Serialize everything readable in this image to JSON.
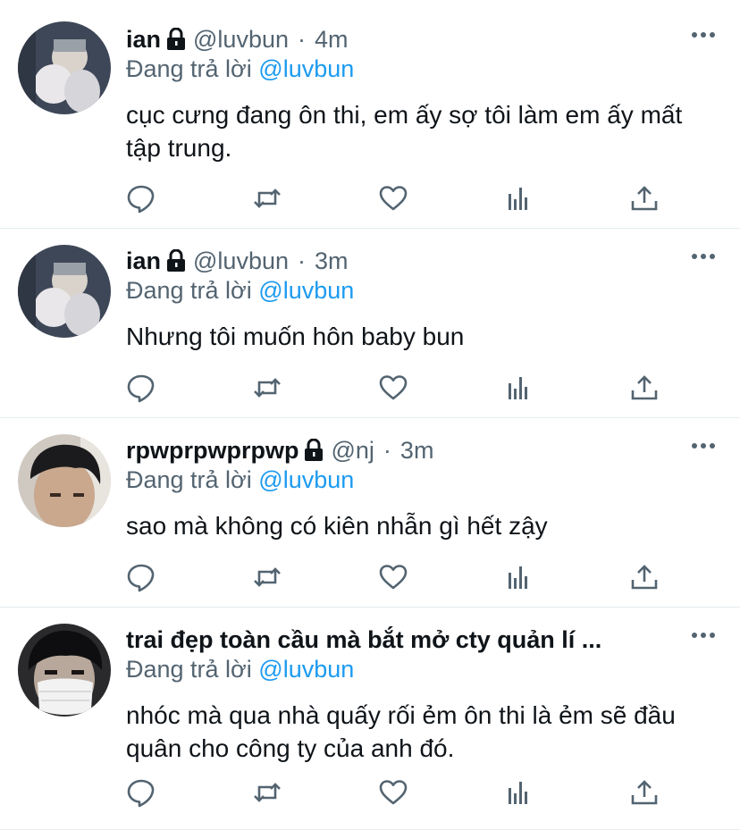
{
  "tweets": [
    {
      "name": "ian",
      "handle": "@luvbun",
      "dot": "·",
      "time": "4m",
      "reply_prefix": "Đang trả lời",
      "reply_to": "@luvbun",
      "text": "cục cưng đang ôn thi, em ấy sợ tôi làm em ấy mất tập trung."
    },
    {
      "name": "ian",
      "handle": "@luvbun",
      "dot": "·",
      "time": "3m",
      "reply_prefix": "Đang trả lời",
      "reply_to": "@luvbun",
      "text": "Nhưng tôi muốn hôn baby bun"
    },
    {
      "name": "rpwprpwprpwp",
      "handle": "@nj",
      "dot": "·",
      "time": "3m",
      "reply_prefix": "Đang trả lời",
      "reply_to": "@luvbun",
      "text": "sao mà không có kiên nhẫn gì hết zậy"
    },
    {
      "name": "trai đẹp toàn cầu mà bắt mở cty quản lí ...",
      "reply_prefix": "Đang trả lời",
      "reply_to": "@luvbun",
      "text": "nhóc mà qua nhà quấy rối ẻm ôn thi là ẻm sẽ đầu quân cho công ty của anh đó."
    }
  ],
  "icons": {
    "reply": "comment-icon",
    "retweet": "retweet-icon",
    "like": "heart-icon",
    "analytics": "analytics-icon",
    "share": "share-icon",
    "more": "more-icon",
    "lock": "lock-icon"
  },
  "colors": {
    "text": "#0f1419",
    "secondary": "#536471",
    "mention": "#1d9bf0",
    "divider": "#e6ecf0"
  }
}
